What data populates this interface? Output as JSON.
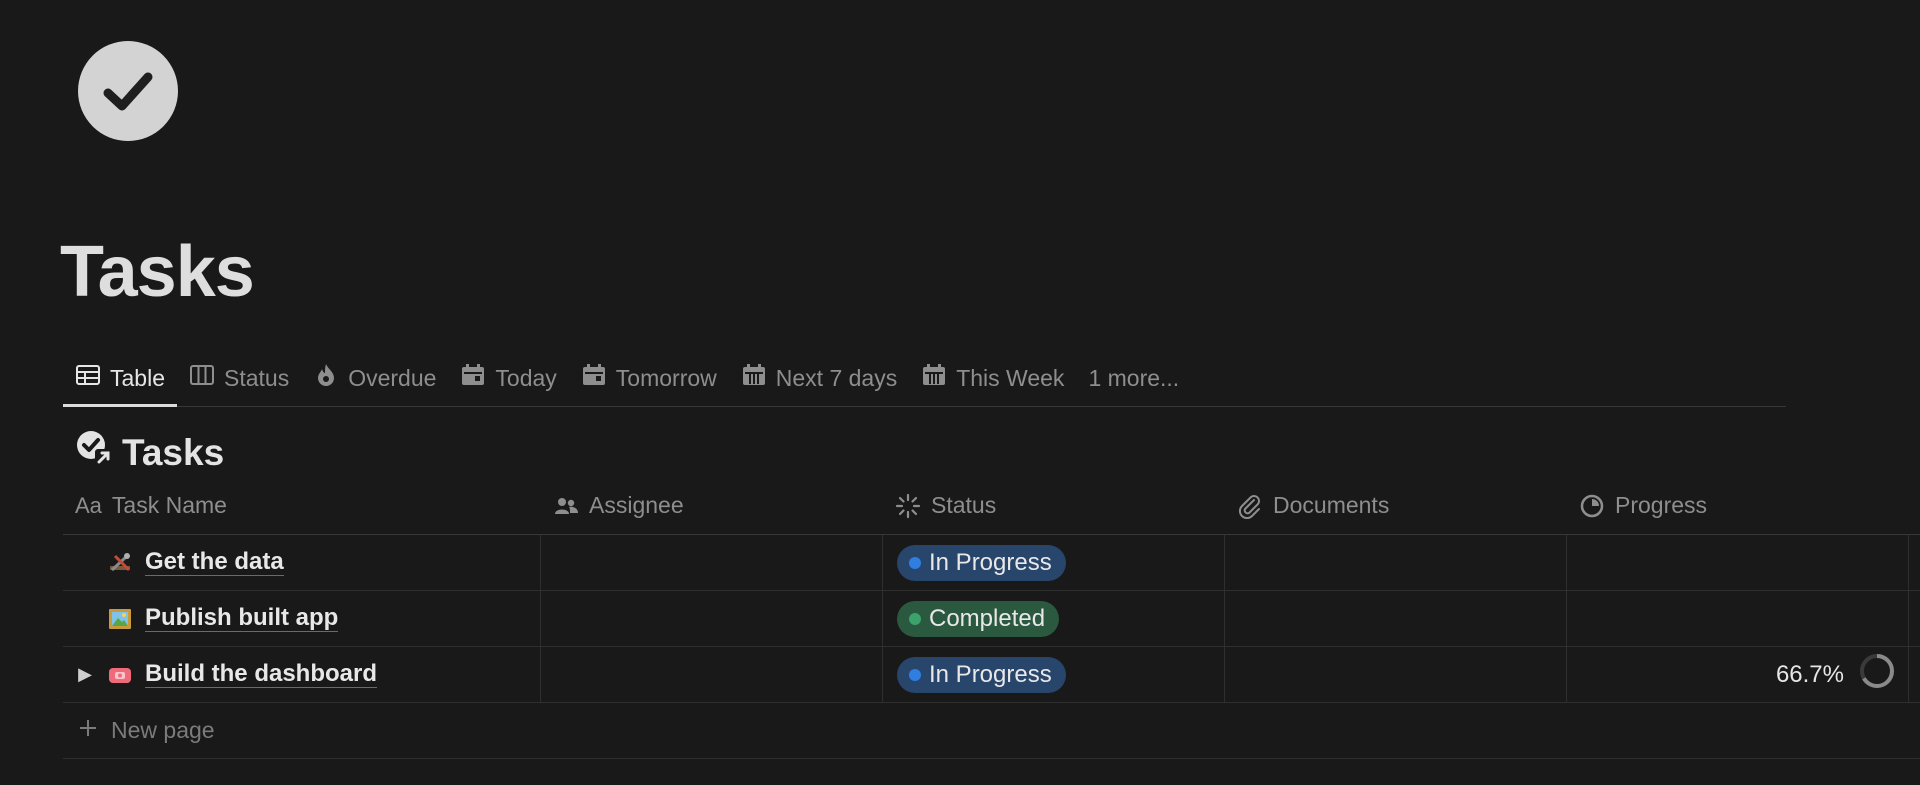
{
  "page": {
    "title": "Tasks",
    "icon": "checkmark-circle-icon"
  },
  "tabs": [
    {
      "label": "Table",
      "icon": "table-icon",
      "active": true
    },
    {
      "label": "Status",
      "icon": "board-icon",
      "active": false
    },
    {
      "label": "Overdue",
      "icon": "fire-icon",
      "active": false
    },
    {
      "label": "Today",
      "icon": "calendar-icon",
      "active": false
    },
    {
      "label": "Tomorrow",
      "icon": "calendar-icon",
      "active": false
    },
    {
      "label": "Next 7 days",
      "icon": "calendar-grid-icon",
      "active": false
    },
    {
      "label": "This Week",
      "icon": "calendar-grid-icon",
      "active": false
    },
    {
      "label": "1 more...",
      "icon": "",
      "active": false
    }
  ],
  "database": {
    "title": "Tasks",
    "icon": "checkmark-circle-link-icon"
  },
  "columns": {
    "name": {
      "label": "Task Name",
      "prefix": "Aa"
    },
    "assignee": {
      "label": "Assignee",
      "icon": "people-icon"
    },
    "status": {
      "label": "Status",
      "icon": "status-spinner-icon"
    },
    "documents": {
      "label": "Documents",
      "icon": "paperclip-icon"
    },
    "progress": {
      "label": "Progress",
      "icon": "progress-pie-icon"
    }
  },
  "rows": [
    {
      "title": "Get the data",
      "emoji": "tools-icon",
      "has_toggle": false,
      "status": "In Progress",
      "status_color": "#2f7fe0",
      "progress": ""
    },
    {
      "title": "Publish built app",
      "emoji": "framed-picture-icon",
      "has_toggle": false,
      "status": "Completed",
      "status_color": "#3aa26a",
      "progress": ""
    },
    {
      "title": "Build the dashboard",
      "emoji": "telephone-icon",
      "has_toggle": true,
      "status": "In Progress",
      "status_color": "#2f7fe0",
      "progress": "66.7%",
      "progress_fraction": 0.667
    }
  ],
  "new_page_label": "New page",
  "colors": {
    "background": "#191919",
    "in_progress_pill": "#28456c",
    "completed_pill": "#2b593f"
  }
}
